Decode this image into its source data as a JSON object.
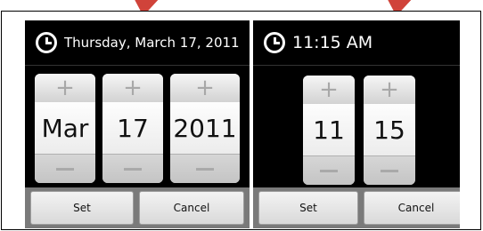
{
  "date_dialog": {
    "title": "Thursday, March 17, 2011",
    "pickers": [
      {
        "name": "month",
        "value": "Mar"
      },
      {
        "name": "day",
        "value": "17"
      },
      {
        "name": "year",
        "value": "2011"
      }
    ],
    "plus_label": "+",
    "set_label": "Set",
    "cancel_label": "Cancel"
  },
  "time_dialog": {
    "title": "11:15 AM",
    "pickers": [
      {
        "name": "hour",
        "value": "11"
      },
      {
        "name": "minute",
        "value": "15"
      }
    ],
    "plus_label": "+",
    "set_label": "Set",
    "cancel_label": "Cancel"
  },
  "colors": {
    "arrow": "#d0433a",
    "dialog_bg": "#000000"
  }
}
